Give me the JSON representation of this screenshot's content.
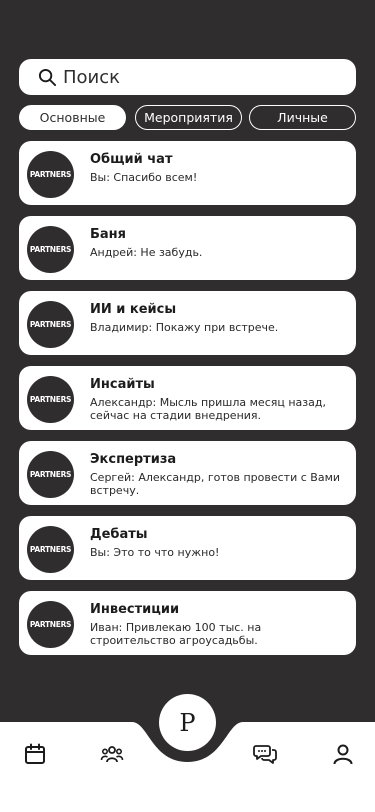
{
  "search": {
    "placeholder": "Поиск"
  },
  "tabs": [
    {
      "label": "Основные",
      "active": true
    },
    {
      "label": "Мероприятия",
      "active": false
    },
    {
      "label": "Личные",
      "active": false
    }
  ],
  "chats": [
    {
      "avatar": "PARTNERS",
      "title": "Общий чат",
      "message": "Вы: Спасибо всем!"
    },
    {
      "avatar": "PARTNERS",
      "title": "Баня",
      "message": "Андрей: Не забудь."
    },
    {
      "avatar": "PARTNERS",
      "title": "ИИ и кейсы",
      "message": "Владимир: Покажу при встрече."
    },
    {
      "avatar": "PARTNERS",
      "title": "Инсайты",
      "message": "Александр: Мысль пришла месяц назад, сейчас на стадии внедрения."
    },
    {
      "avatar": "PARTNERS",
      "title": "Экспертиза",
      "message": "Сергей: Александр, готов провести с Вами встречу."
    },
    {
      "avatar": "PARTNERS",
      "title": "Дебаты",
      "message": "Вы: Это то что нужно!"
    },
    {
      "avatar": "PARTNERS",
      "title": "Инвестиции",
      "message": "Иван: Привлекаю 100 тыс. на строительство агроусадьбы."
    }
  ],
  "navbar": {
    "center_label": "P",
    "icons": [
      "calendar-icon",
      "people-icon",
      "chat-bubbles-icon",
      "profile-icon"
    ]
  },
  "colors": {
    "background": "#2f2d2e",
    "surface": "#ffffff",
    "text": "#1c1c1c"
  }
}
